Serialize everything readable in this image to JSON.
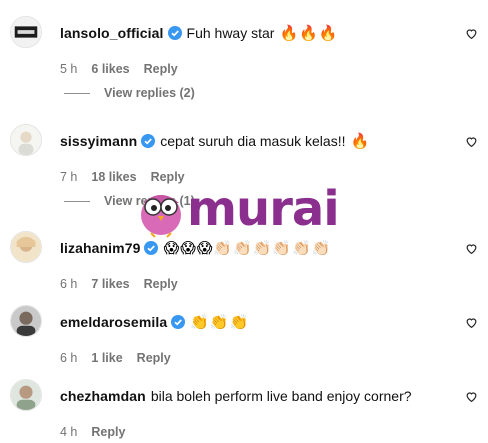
{
  "comments": [
    {
      "username": "lansolo_official",
      "verified": true,
      "text": "Fuh hway star",
      "emojis": "🔥🔥🔥",
      "time": "5 h",
      "likes": "6 likes",
      "reply_label": "Reply",
      "view_replies": "View replies (2)"
    },
    {
      "username": "sissyimann",
      "verified": true,
      "text": "cepat suruh dia masuk kelas!!",
      "emojis": "🔥",
      "time": "7 h",
      "likes": "18 likes",
      "reply_label": "Reply",
      "view_replies": "View replies (1)"
    },
    {
      "username": "lizahanim79",
      "verified": true,
      "text": "",
      "emojis": "😱😱😱👏🏻👏🏻👏🏻👏🏻👏🏻👏🏻",
      "time": "6 h",
      "likes": "7 likes",
      "reply_label": "Reply"
    },
    {
      "username": "emeldarosemila",
      "verified": true,
      "text": "",
      "emojis": "👏👏👏",
      "time": "6 h",
      "likes": "1 like",
      "reply_label": "Reply"
    },
    {
      "username": "chezhamdan",
      "verified": false,
      "text": "bila boleh perform live band enjoy corner?",
      "emojis": "",
      "time": "4 h",
      "likes": "",
      "reply_label": "Reply"
    }
  ],
  "watermark": {
    "word": "murai",
    "color": "#8a2f8e"
  },
  "colors": {
    "verified_blue": "#3897f0",
    "meta_gray": "#737373"
  }
}
